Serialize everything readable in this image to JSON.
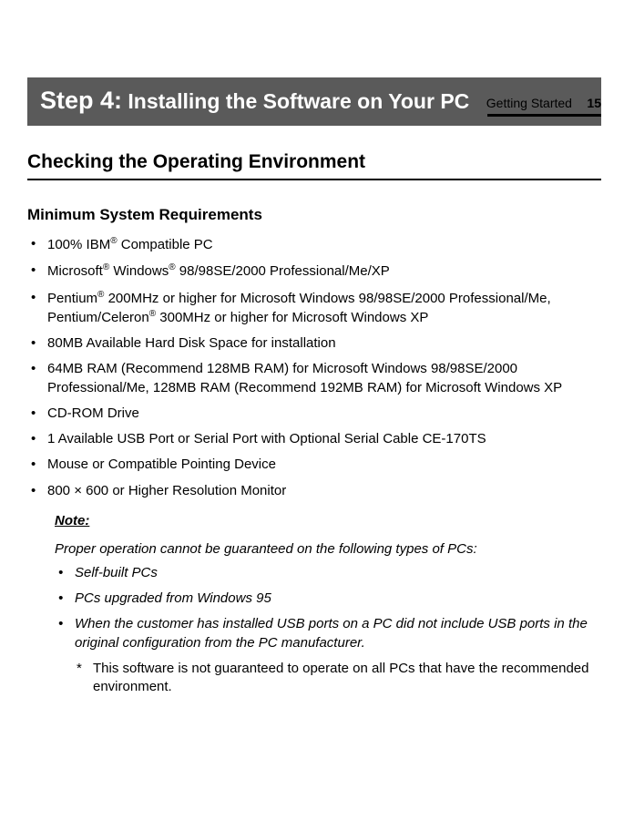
{
  "header": {
    "section": "Getting Started",
    "page": "15"
  },
  "banner": {
    "prefix": "Step 4:",
    "title": " Installing the Software on Your PC"
  },
  "section": {
    "title": "Checking the Operating Environment"
  },
  "subsection": {
    "title": "Minimum System Requirements"
  },
  "requirements": {
    "items": [
      {
        "pre": "100% IBM",
        "reg1": "®",
        "post": " Compatible PC"
      },
      {
        "pre": "Microsoft",
        "reg1": "®",
        "mid": " Windows",
        "reg2": "®",
        "post": " 98/98SE/2000 Professional/Me/XP"
      },
      {
        "pre": "Pentium",
        "reg1": "®",
        "mid": " 200MHz or higher for Microsoft Windows 98/98SE/2000 Professional/Me, Pentium/Celeron",
        "reg2": "®",
        "post": " 300MHz or higher for Microsoft Windows XP"
      },
      {
        "pre": "80MB Available Hard Disk Space for installation"
      },
      {
        "pre": "64MB RAM (Recommend 128MB RAM) for Microsoft Windows 98/98SE/2000 Professional/Me, 128MB RAM (Recommend 192MB RAM) for Microsoft Windows XP"
      },
      {
        "pre": "CD-ROM Drive"
      },
      {
        "pre": "1 Available USB Port or Serial Port with Optional Serial Cable CE-170TS"
      },
      {
        "pre": "Mouse or Compatible Pointing Device"
      },
      {
        "pre": "800 × 600 or Higher Resolution Monitor"
      }
    ]
  },
  "note": {
    "label": "Note:",
    "intro": "Proper operation cannot be guaranteed on the following types of PCs:",
    "items": [
      "Self-built PCs",
      "PCs upgraded from Windows 95",
      "When the customer has installed USB ports on a PC did not include USB ports in the original configuration from the PC manufacturer."
    ],
    "asterisk": "This software is not guaranteed to operate on all PCs that have the recommended environment."
  }
}
